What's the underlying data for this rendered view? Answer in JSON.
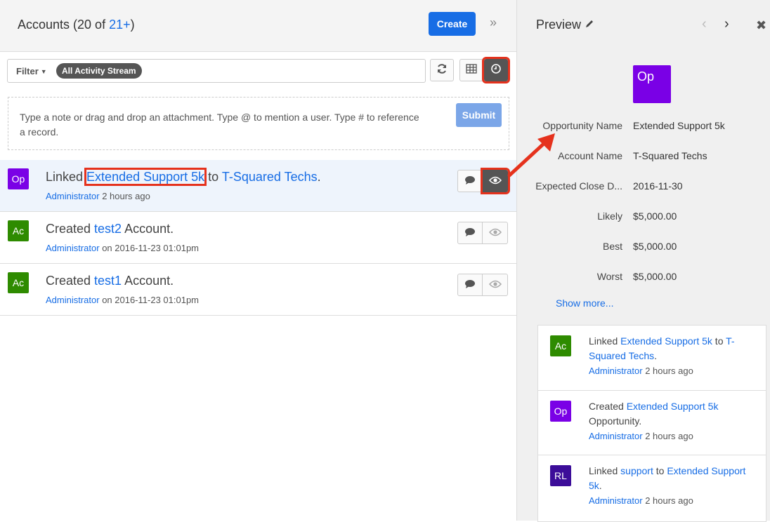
{
  "header": {
    "title_prefix": "Accounts (20 of ",
    "title_count": "21+",
    "title_suffix": ")",
    "create_label": "Create",
    "collapse_glyph": "»"
  },
  "filter": {
    "label": "Filter",
    "pill": "All Activity Stream"
  },
  "toolbar_icons": [
    "refresh-icon",
    "table-icon",
    "clock-icon"
  ],
  "note": {
    "placeholder": "Type a note or drag and drop an attachment. Type @ to mention a user. Type # to reference a record.",
    "submit_label": "Submit"
  },
  "stream": [
    {
      "avatar": "Op",
      "verb": "Linked ",
      "link1": "Extended Support 5k",
      "mid": " to ",
      "link2": "T-Squared Techs",
      "end": ".",
      "author": "Administrator",
      "time": " 2 hours ago"
    },
    {
      "avatar": "Ac",
      "verb": "Created ",
      "link1": "test2",
      "mid": " Account.",
      "author": "Administrator",
      "time": " on 2016-11-23 01:01pm"
    },
    {
      "avatar": "Ac",
      "verb": "Created ",
      "link1": "test1",
      "mid": " Account.",
      "author": "Administrator",
      "time": " on 2016-11-23 01:01pm"
    }
  ],
  "preview": {
    "title": "Preview",
    "avatar": "Op",
    "fields": [
      {
        "label": "Opportunity Name",
        "value": "Extended Support 5k",
        "link": true
      },
      {
        "label": "Account Name",
        "value": "T-Squared Techs",
        "link": true
      },
      {
        "label": "Expected Close D...",
        "value": "2016-11-30",
        "link": false
      },
      {
        "label": "Likely",
        "value": "$5,000.00",
        "link": false
      },
      {
        "label": "Best",
        "value": "$5,000.00",
        "link": false
      },
      {
        "label": "Worst",
        "value": "$5,000.00",
        "link": false
      }
    ],
    "show_more": "Show more...",
    "mini_stream": [
      {
        "avatar": "Ac",
        "verb": "Linked ",
        "link1": "Extended Support 5k",
        "mid": " to ",
        "link2": "T-Squared Techs",
        "end": ".",
        "author": "Administrator",
        "time": " 2 hours ago"
      },
      {
        "avatar": "Op",
        "verb": "Created ",
        "link1": "Extended Support 5k",
        "mid": " Opportunity.",
        "author": "Administrator",
        "time": " 2 hours ago"
      },
      {
        "avatar": "RL",
        "verb": "Linked ",
        "link1": "support",
        "mid": " to ",
        "link2": "Extended Support 5k",
        "end": ".",
        "author": "Administrator",
        "time": " 2 hours ago"
      }
    ]
  },
  "colors": {
    "accent": "#176de5",
    "highlight": "#e5321d",
    "avatar_op": "#7a00e6",
    "avatar_ac": "#2e8b00",
    "avatar_rl": "#3c0d99"
  }
}
